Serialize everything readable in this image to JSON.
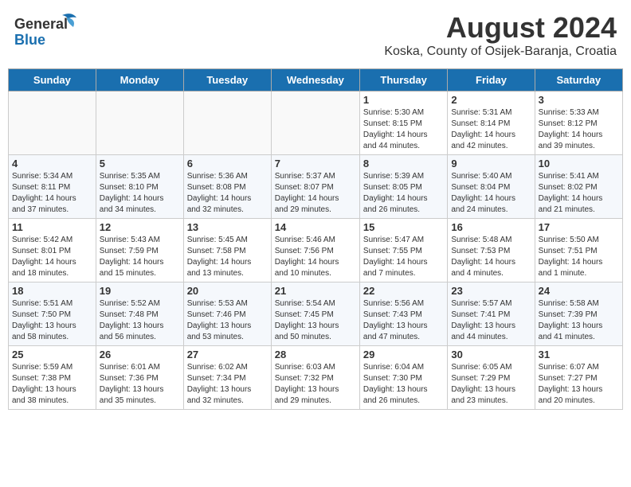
{
  "header": {
    "logo_line1": "General",
    "logo_line2": "Blue",
    "main_title": "August 2024",
    "subtitle": "Koska, County of Osijek-Baranja, Croatia"
  },
  "days_of_week": [
    "Sunday",
    "Monday",
    "Tuesday",
    "Wednesday",
    "Thursday",
    "Friday",
    "Saturday"
  ],
  "weeks": [
    [
      {
        "day": "",
        "info": ""
      },
      {
        "day": "",
        "info": ""
      },
      {
        "day": "",
        "info": ""
      },
      {
        "day": "",
        "info": ""
      },
      {
        "day": "1",
        "info": "Sunrise: 5:30 AM\nSunset: 8:15 PM\nDaylight: 14 hours\nand 44 minutes."
      },
      {
        "day": "2",
        "info": "Sunrise: 5:31 AM\nSunset: 8:14 PM\nDaylight: 14 hours\nand 42 minutes."
      },
      {
        "day": "3",
        "info": "Sunrise: 5:33 AM\nSunset: 8:12 PM\nDaylight: 14 hours\nand 39 minutes."
      }
    ],
    [
      {
        "day": "4",
        "info": "Sunrise: 5:34 AM\nSunset: 8:11 PM\nDaylight: 14 hours\nand 37 minutes."
      },
      {
        "day": "5",
        "info": "Sunrise: 5:35 AM\nSunset: 8:10 PM\nDaylight: 14 hours\nand 34 minutes."
      },
      {
        "day": "6",
        "info": "Sunrise: 5:36 AM\nSunset: 8:08 PM\nDaylight: 14 hours\nand 32 minutes."
      },
      {
        "day": "7",
        "info": "Sunrise: 5:37 AM\nSunset: 8:07 PM\nDaylight: 14 hours\nand 29 minutes."
      },
      {
        "day": "8",
        "info": "Sunrise: 5:39 AM\nSunset: 8:05 PM\nDaylight: 14 hours\nand 26 minutes."
      },
      {
        "day": "9",
        "info": "Sunrise: 5:40 AM\nSunset: 8:04 PM\nDaylight: 14 hours\nand 24 minutes."
      },
      {
        "day": "10",
        "info": "Sunrise: 5:41 AM\nSunset: 8:02 PM\nDaylight: 14 hours\nand 21 minutes."
      }
    ],
    [
      {
        "day": "11",
        "info": "Sunrise: 5:42 AM\nSunset: 8:01 PM\nDaylight: 14 hours\nand 18 minutes."
      },
      {
        "day": "12",
        "info": "Sunrise: 5:43 AM\nSunset: 7:59 PM\nDaylight: 14 hours\nand 15 minutes."
      },
      {
        "day": "13",
        "info": "Sunrise: 5:45 AM\nSunset: 7:58 PM\nDaylight: 14 hours\nand 13 minutes."
      },
      {
        "day": "14",
        "info": "Sunrise: 5:46 AM\nSunset: 7:56 PM\nDaylight: 14 hours\nand 10 minutes."
      },
      {
        "day": "15",
        "info": "Sunrise: 5:47 AM\nSunset: 7:55 PM\nDaylight: 14 hours\nand 7 minutes."
      },
      {
        "day": "16",
        "info": "Sunrise: 5:48 AM\nSunset: 7:53 PM\nDaylight: 14 hours\nand 4 minutes."
      },
      {
        "day": "17",
        "info": "Sunrise: 5:50 AM\nSunset: 7:51 PM\nDaylight: 14 hours\nand 1 minute."
      }
    ],
    [
      {
        "day": "18",
        "info": "Sunrise: 5:51 AM\nSunset: 7:50 PM\nDaylight: 13 hours\nand 58 minutes."
      },
      {
        "day": "19",
        "info": "Sunrise: 5:52 AM\nSunset: 7:48 PM\nDaylight: 13 hours\nand 56 minutes."
      },
      {
        "day": "20",
        "info": "Sunrise: 5:53 AM\nSunset: 7:46 PM\nDaylight: 13 hours\nand 53 minutes."
      },
      {
        "day": "21",
        "info": "Sunrise: 5:54 AM\nSunset: 7:45 PM\nDaylight: 13 hours\nand 50 minutes."
      },
      {
        "day": "22",
        "info": "Sunrise: 5:56 AM\nSunset: 7:43 PM\nDaylight: 13 hours\nand 47 minutes."
      },
      {
        "day": "23",
        "info": "Sunrise: 5:57 AM\nSunset: 7:41 PM\nDaylight: 13 hours\nand 44 minutes."
      },
      {
        "day": "24",
        "info": "Sunrise: 5:58 AM\nSunset: 7:39 PM\nDaylight: 13 hours\nand 41 minutes."
      }
    ],
    [
      {
        "day": "25",
        "info": "Sunrise: 5:59 AM\nSunset: 7:38 PM\nDaylight: 13 hours\nand 38 minutes."
      },
      {
        "day": "26",
        "info": "Sunrise: 6:01 AM\nSunset: 7:36 PM\nDaylight: 13 hours\nand 35 minutes."
      },
      {
        "day": "27",
        "info": "Sunrise: 6:02 AM\nSunset: 7:34 PM\nDaylight: 13 hours\nand 32 minutes."
      },
      {
        "day": "28",
        "info": "Sunrise: 6:03 AM\nSunset: 7:32 PM\nDaylight: 13 hours\nand 29 minutes."
      },
      {
        "day": "29",
        "info": "Sunrise: 6:04 AM\nSunset: 7:30 PM\nDaylight: 13 hours\nand 26 minutes."
      },
      {
        "day": "30",
        "info": "Sunrise: 6:05 AM\nSunset: 7:29 PM\nDaylight: 13 hours\nand 23 minutes."
      },
      {
        "day": "31",
        "info": "Sunrise: 6:07 AM\nSunset: 7:27 PM\nDaylight: 13 hours\nand 20 minutes."
      }
    ]
  ]
}
